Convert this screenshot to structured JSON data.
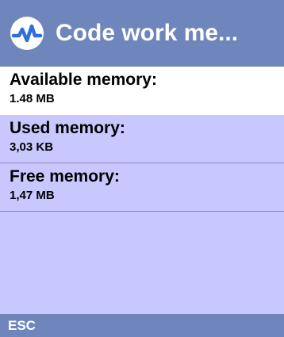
{
  "header": {
    "title": "Code work me...",
    "icon": "activity-waveform-icon"
  },
  "memory_list": {
    "items": [
      {
        "label": "Available memory:",
        "value": "1.48 MB",
        "selected": true
      },
      {
        "label": "Used memory:",
        "value": "3,03 KB",
        "selected": false
      },
      {
        "label": "Free memory:",
        "value": "1,47 MB",
        "selected": false
      }
    ]
  },
  "softkeys": {
    "left_label": "ESC"
  },
  "colors": {
    "title_bar": "#6e86bb",
    "list_background": "#c8c8ff",
    "selected_item": "#ffffff",
    "text": "#000000",
    "title_text": "#ffffff"
  }
}
